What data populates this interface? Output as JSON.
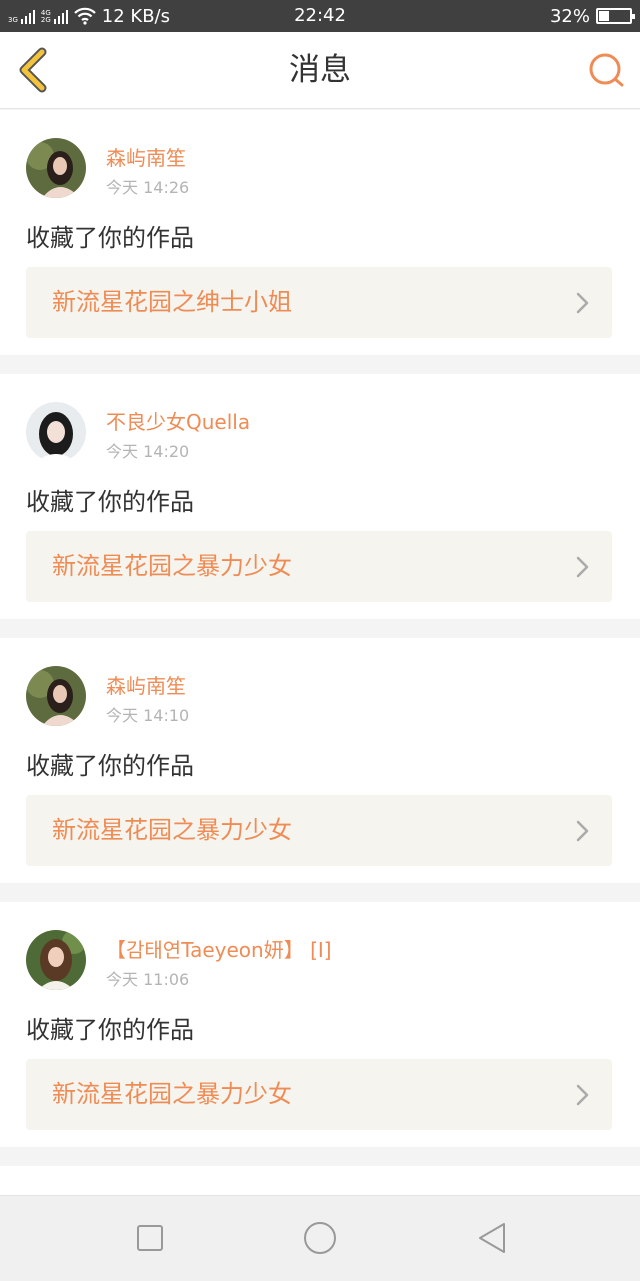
{
  "status_bar": {
    "network_1": "3G",
    "network_2a": "4G",
    "network_2b": "2G",
    "speed": "12 KB/s",
    "time": "22:42",
    "battery": "32%",
    "battery_level": 0.32
  },
  "header": {
    "title": "消息"
  },
  "messages": [
    {
      "user": "森屿南笙",
      "time": "今天 14:26",
      "action": "收藏了你的作品",
      "work": "新流星花园之绅士小姐"
    },
    {
      "user": "不良少女Quella",
      "time": "今天 14:20",
      "action": "收藏了你的作品",
      "work": "新流星花园之暴力少女"
    },
    {
      "user": "森屿南笙",
      "time": "今天 14:10",
      "action": "收藏了你的作品",
      "work": "新流星花园之暴力少女"
    },
    {
      "user": "【감태연Taeyeon妍】 [I]",
      "time": "今天 11:06",
      "action": "收藏了你的作品",
      "work": "新流星花园之暴力少女"
    }
  ],
  "colors": {
    "accent": "#ef8c55",
    "back_icon": "#f3c33b",
    "text": "#333333",
    "muted": "#b4b4b4",
    "card_inner": "#f5f4ee"
  },
  "icons": {
    "back": "chevron-left-icon",
    "search": "search-icon",
    "row_chevron": "chevron-right-icon",
    "nav_recent": "square-icon",
    "nav_home": "circle-icon",
    "nav_back": "triangle-left-icon"
  }
}
